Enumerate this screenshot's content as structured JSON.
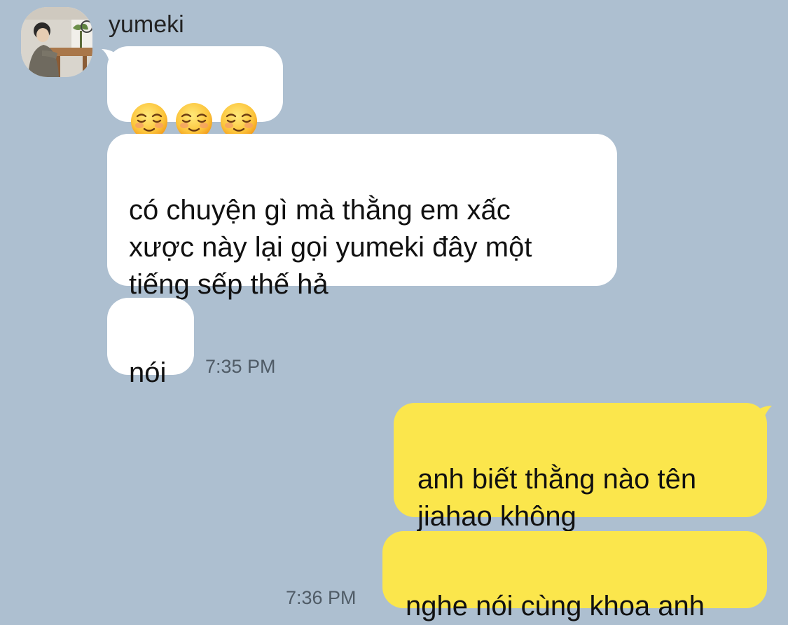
{
  "conversation": {
    "contact_name": "yumeki",
    "incoming": {
      "emoji_message": {
        "emoji_name": "smiling-face-icon",
        "count": 3
      },
      "message_2": "có chuyện gì mà thằng em xấc\nxược này lại gọi yumeki đây một\ntiếng sếp thế hả",
      "message_3": "nói",
      "timestamp": "7:35 PM"
    },
    "outgoing": {
      "message_1": "anh biết thằng nào tên\njiahao không",
      "message_2": "nghe nói cùng khoa anh",
      "timestamp": "7:36 PM"
    }
  },
  "colors": {
    "background": "#adbfd0",
    "incoming_bubble": "#ffffff",
    "outgoing_bubble": "#fbe64c",
    "timestamp": "#4f5b66"
  }
}
